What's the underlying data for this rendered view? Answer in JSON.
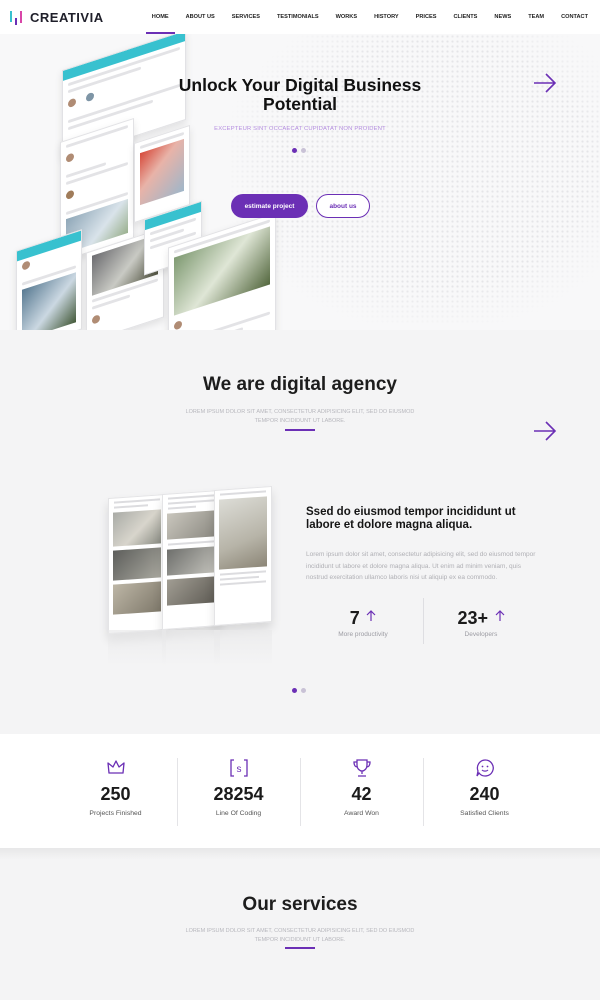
{
  "brand": {
    "name": "CREATIVIA",
    "colors": {
      "primary": "#6b2fb5",
      "teal": "#38c1cf",
      "pink": "#d946a8"
    }
  },
  "nav": {
    "items": [
      {
        "label": "HOME",
        "active": true
      },
      {
        "label": "ABOUT US",
        "active": false
      },
      {
        "label": "SERVICES",
        "active": false
      },
      {
        "label": "TESTIMONIALS",
        "active": false
      },
      {
        "label": "WORKS",
        "active": false
      },
      {
        "label": "HISTORY",
        "active": false
      },
      {
        "label": "PRICES",
        "active": false
      },
      {
        "label": "CLIENTS",
        "active": false
      },
      {
        "label": "NEWS",
        "active": false
      },
      {
        "label": "TEAM",
        "active": false
      },
      {
        "label": "CONTACT",
        "active": false
      }
    ]
  },
  "hero": {
    "title": "Unlock Your Digital Business Potential",
    "subtitle": "EXCEPTEUR SINT OCCAECAT CUPIDATAT NON PROIDENT",
    "primary_button": "estimate project",
    "secondary_button": "about us",
    "slides": 2,
    "active_slide": 1
  },
  "agency": {
    "title": "We are digital agency",
    "subtitle": "LOREM IPSUM DOLOR SIT AMET, CONSECTETUR ADIPISICING ELIT, SED DO EIUSMOD TEMPOR INCIDIDUNT UT LABORE.",
    "heading": "Ssed do eiusmod tempor incididunt ut labore et dolore magna aliqua.",
    "body": "Lorem ipsum dolor sit amet, consectetur adipisicing elit, sed do eiusmod tempor incididunt ut labore et dolore magna aliqua. Ut enim ad minim veniam, quis nostrud exercitation ullamco laboris nisi ut aliquip ex ea commodo.",
    "stats": [
      {
        "value": "7",
        "label": "More productivity",
        "icon": "arrow-up-icon"
      },
      {
        "value": "23+",
        "label": "Developers",
        "icon": "arrow-up-icon"
      }
    ],
    "slides": 2,
    "active_slide": 1
  },
  "counters": [
    {
      "icon": "crown-icon",
      "value": "250",
      "label": "Projects Finished"
    },
    {
      "icon": "code-bracket-icon",
      "value": "28254",
      "label": "Line Of Coding"
    },
    {
      "icon": "trophy-icon",
      "value": "42",
      "label": "Award Won"
    },
    {
      "icon": "smiley-chat-icon",
      "value": "240",
      "label": "Satisfied Clients"
    }
  ],
  "services": {
    "title": "Our services",
    "subtitle": "LOREM IPSUM DOLOR SIT AMET, CONSECTETUR ADIPISICING ELIT, SED DO EIUSMOD TEMPOR INCIDIDUNT UT LABORE."
  }
}
